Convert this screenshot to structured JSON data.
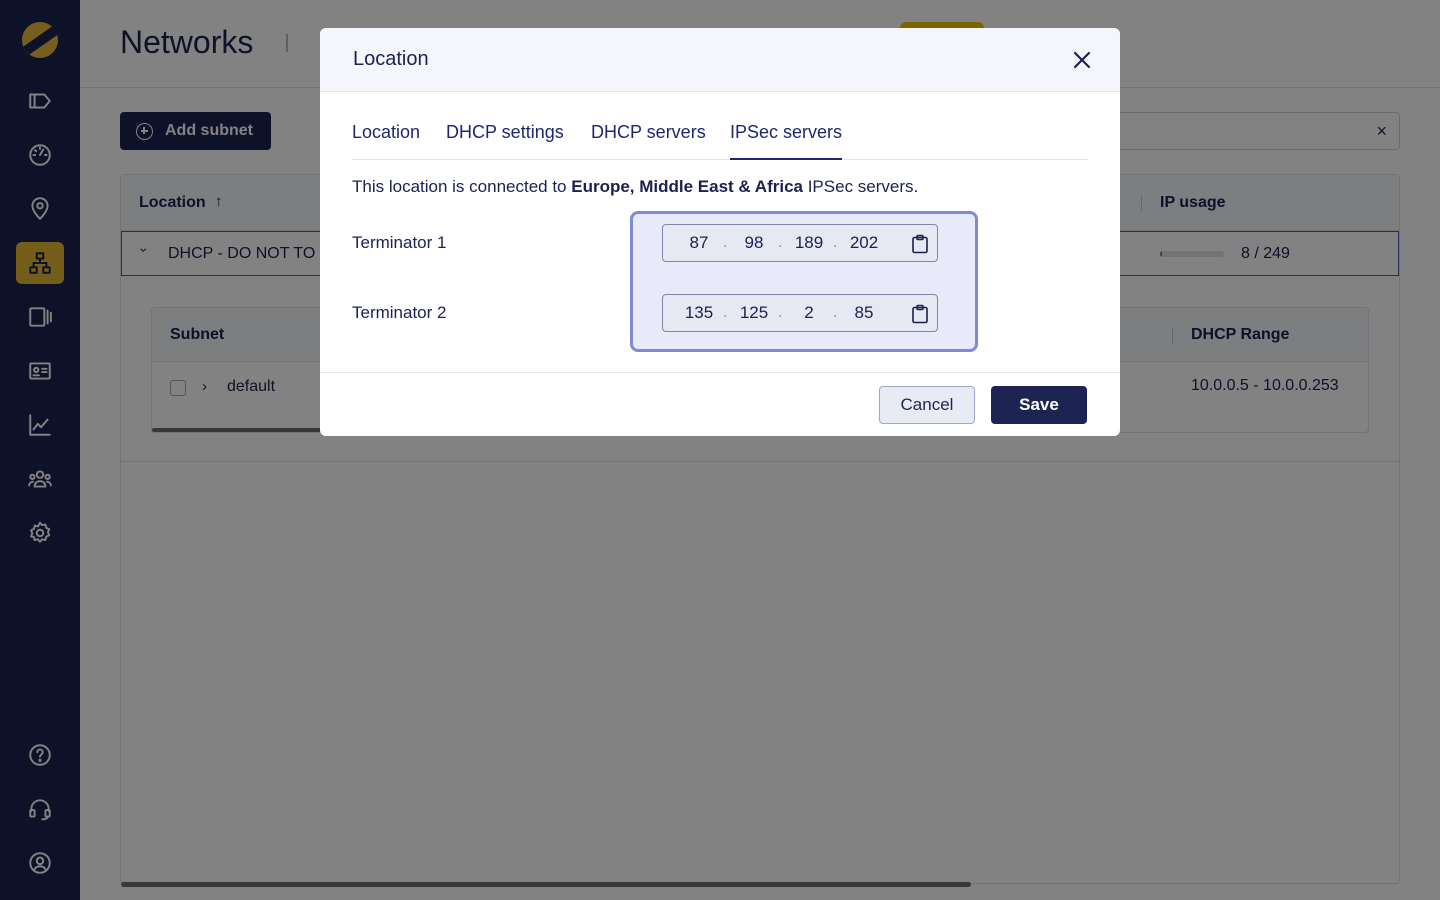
{
  "sidebar": {
    "items": [
      {
        "name": "tag-icon"
      },
      {
        "name": "dashboard-gauge-icon"
      },
      {
        "name": "location-pin-icon"
      },
      {
        "name": "network-icon",
        "active": true
      },
      {
        "name": "devices-icon"
      },
      {
        "name": "id-card-icon"
      },
      {
        "name": "chart-line-icon"
      },
      {
        "name": "users-icon"
      },
      {
        "name": "gear-icon"
      }
    ],
    "bottom_items": [
      {
        "name": "help-icon"
      },
      {
        "name": "headset-icon"
      },
      {
        "name": "user-profile-icon"
      }
    ]
  },
  "header": {
    "title": "Networks"
  },
  "toolbar": {
    "add_subnet_label": "Add subnet",
    "search_clear": "×"
  },
  "table": {
    "columns": {
      "location": "Location",
      "location_sort": "↑",
      "ip_usage": "IP usage"
    },
    "group_row": {
      "chevron": "›",
      "name": "DHCP - DO NOT TO",
      "usage_text": "8 / 249",
      "usage_fraction": 0.032
    },
    "subtable": {
      "columns": {
        "subnet": "Subnet",
        "dhcp_range": "DHCP Range"
      },
      "rows": [
        {
          "chevron": "›",
          "name": "default",
          "dhcp_range": "10.0.0.5 - 10.0.0.253"
        }
      ]
    }
  },
  "modal": {
    "title": "Location",
    "tabs": [
      {
        "label": "Location"
      },
      {
        "label": "DHCP settings"
      },
      {
        "label": "DHCP servers"
      },
      {
        "label": "IPSec servers",
        "active": true
      }
    ],
    "description": {
      "prefix": "This location is connected to ",
      "region": "Europe, Middle East & Africa",
      "suffix": " IPSec servers."
    },
    "terminators": [
      {
        "label": "Terminator 1",
        "octets": [
          "87",
          "98",
          "189",
          "202"
        ]
      },
      {
        "label": "Terminator 2",
        "octets": [
          "135",
          "125",
          "2",
          "85"
        ]
      }
    ],
    "dot": ".",
    "cancel_label": "Cancel",
    "save_label": "Save"
  },
  "colors": {
    "sidebar_bg": "#1d2452",
    "accent": "#e5b734",
    "primary": "#1d2452",
    "tab_text": "#1d2771",
    "focus_ring": "#7e8ad6"
  }
}
